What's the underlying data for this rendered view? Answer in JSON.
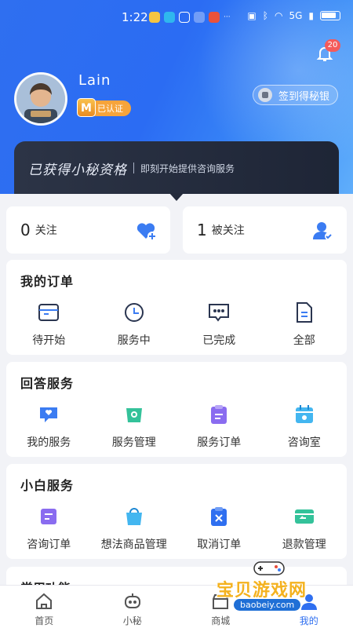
{
  "status_bar": {
    "time": "1:22",
    "more": "···",
    "signal": "5G"
  },
  "header": {
    "notification_count": "20",
    "username": "Lain",
    "verify_badge": "M",
    "verify_label": "已认证",
    "signin_label": "签到得秘银"
  },
  "banner": {
    "title": "已获得小秘资格",
    "subtitle": "即刻开始提供咨询服务"
  },
  "follow": {
    "following": {
      "count": "0",
      "label": "关注"
    },
    "followers": {
      "count": "1",
      "label": "被关注"
    }
  },
  "orders": {
    "title": "我的订单",
    "items": [
      {
        "label": "待开始",
        "icon": "card-icon"
      },
      {
        "label": "服务中",
        "icon": "clock-icon"
      },
      {
        "label": "已完成",
        "icon": "chat-bubble-icon"
      },
      {
        "label": "全部",
        "icon": "document-icon"
      }
    ]
  },
  "answer_service": {
    "title": "回答服务",
    "items": [
      {
        "label": "我的服务",
        "icon": "heart-chat-icon"
      },
      {
        "label": "服务管理",
        "icon": "gear-icon"
      },
      {
        "label": "服务订单",
        "icon": "clipboard-icon"
      },
      {
        "label": "咨询室",
        "icon": "calendar-icon"
      }
    ]
  },
  "newbie_service": {
    "title": "小白服务",
    "items": [
      {
        "label": "咨询订单",
        "icon": "list-icon"
      },
      {
        "label": "想法商品管理",
        "icon": "shopping-bag-icon"
      },
      {
        "label": "取消订单",
        "icon": "cancel-clipboard-icon"
      },
      {
        "label": "退款管理",
        "icon": "refund-wallet-icon"
      }
    ]
  },
  "common_functions": {
    "title": "常用功能"
  },
  "tabbar": [
    {
      "label": "首页",
      "icon": "home-icon"
    },
    {
      "label": "小秘",
      "icon": "robot-icon"
    },
    {
      "label": "商城",
      "icon": "store-icon"
    },
    {
      "label": "我的",
      "icon": "user-icon"
    }
  ],
  "watermark": {
    "text": "宝贝游戏网",
    "url": "baobeiy.com"
  },
  "colors": {
    "accent": "#2f6ff0",
    "badge": "#f45b5b",
    "verify": "#f6a43b"
  }
}
